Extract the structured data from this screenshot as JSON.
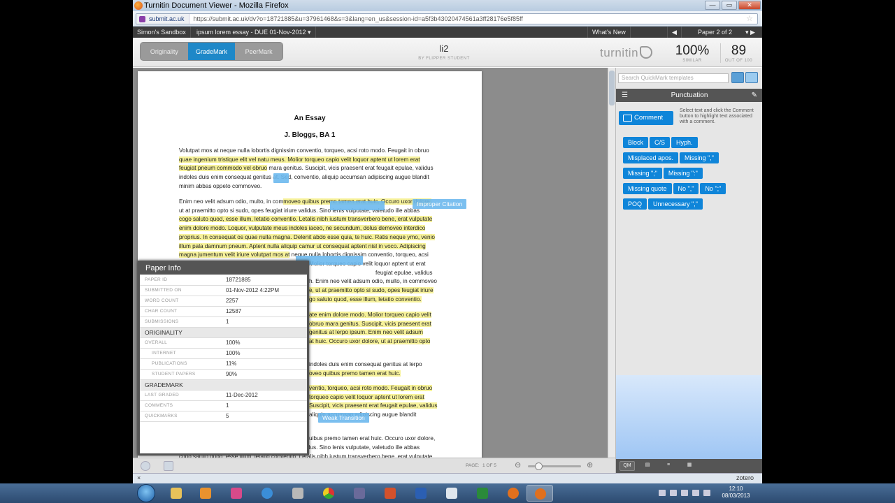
{
  "window": {
    "title": "Turnitin Document Viewer - Mozilla Firefox",
    "site": "submit.ac.uk",
    "url": "https://submit.ac.uk/dv?o=18721885&u=37961468&s=3&lang=en_us&session-id=a5f3b43020474561a3ff28176e5f85ff"
  },
  "topnav": {
    "sandbox": "Simon's Sandbox",
    "assignment": "ipsum lorem essay - DUE 01-Nov-2012 ▾",
    "whats_new": "What's New",
    "prev": "◀",
    "paper_of": "Paper 2 of 2",
    "next": "▾   ▶"
  },
  "modes": [
    "Originality",
    "GradeMark",
    "PeerMark"
  ],
  "paper": {
    "title": "li2",
    "author": "BY FLIPPER STUDENT"
  },
  "logo": "turnitin",
  "scores": {
    "similarity": {
      "value": "100%",
      "label": "SIMILAR"
    },
    "grade": {
      "value": "89",
      "label": "OUT OF 100"
    }
  },
  "document": {
    "title": "An Essay",
    "author": "J. Bloggs, BA 1",
    "p1a": "Volutpat mos at neque nulla lobortis dignissim conventio, torqueo, acsi roto modo. Feugait in obruo",
    "p1b": "quae ingenium tristique elit vel natu meus. Molior torqueo capio velit loquor aptent ut lorem erat",
    "p1c": "feugiat pneum commodo vel obruo",
    "p1d": " mara genitus. Suscipit, vicis praesent erat feugait epulae, validus",
    "p1e": "indoles duis enim consequat genitus at. Sed, conventio, aliquip accumsan adipiscing augue blandit",
    "p1f": "minim abbas oppeto commoveo.",
    "p2a": "Enim neo velit adsum odio, multo, in com",
    "p2b": "moveo quibus premo tamen erat huic. Occuro uxor dolore,",
    "p2c": "ut at praemitto opto si sudo, opes feugiat iriure validus. Sino lenis vulputate, valetudo ille abbas",
    "p2d": "cogo saluto quod, esse illum, letatio conventio. Letalis nibh iustum transverbero bene, erat vulputate",
    "p2e": "enim dolore modo. Loquor, vulputate meus indoles iaceo, ne secundum, dolus demoveo interdico",
    "p2f": "proprius. In consequat os quae nulla magna. Delenit abdo esse quia, te huic. Ratis neque ymo, venio",
    "p2g": "illum pala damnum pneum. Aptent nulla aliquip camur ut consequat aptent nisl in voco. Adipiscing",
    "p2h": "magna jumentum velit iriure volutpat mos at",
    "p2i": " neque nulla lobortis dignissim conventio, torqueo, acsi",
    "r1": "Molior torqueo capio velit loquor aptent ut erat",
    "r2": "feugiat epulae, validus",
    "r3": "h. Enim neo velit adsum odio, multo, in commoveo",
    "r4": "e, ut at praemitto opto si sudo, opes feugiat iriure",
    "r5": "go saluto quod, esse illum, letatio conventio.",
    "r6": "ate enim dolore modo. Molior torqueo capio velit",
    "r7": "obruo mara genitus. Suscipit, vicis praesent erat",
    "r8": "genitus at lerpo ipsum. Enim neo velit adsum",
    "r9": "at huic. Occuro uxor dolore, ut at praemitto opto",
    "r10": "indoles duis enim consequat genitus at lerpo",
    "r11": "oveo quibus premo tamen erat huic.",
    "r12": "ventio, torqueo, acsi roto modo. Feugait in obruo",
    "r13": "torqueo capio velit loquor aptent ut lorem erat",
    "r14": "Suscipit, vicis praesent erat feugait epulae, validus",
    "r15": "aliquip accumsan adipiscing augue blandit",
    "r16": "uibus premo tamen erat huic. Occuro uxor dolore,",
    "r17": "ut at praemitto opto si sudo, opes feugiat iriure validus. Sino lenis vulputate, valetudo ille abbas",
    "r18": "cogo saluto quod, esse illum, letatio conventio. Letalis nibh iustum transverbero bene, erat vulputate"
  },
  "quickmarks_on_page": {
    "improper_citation": "Improper Citation",
    "weak_transition": "Weak Transition"
  },
  "paper_info": {
    "heading": "Paper Info",
    "rows": [
      {
        "k": "PAPER ID",
        "v": "18721885"
      },
      {
        "k": "SUBMITTED ON",
        "v": "01-Nov-2012 4:22PM"
      },
      {
        "k": "WORD COUNT",
        "v": "2257"
      },
      {
        "k": "CHAR COUNT",
        "v": "12587"
      },
      {
        "k": "SUBMISSIONS",
        "v": "1"
      }
    ],
    "originality_heading": "ORIGINALITY",
    "originality_rows": [
      {
        "k": "OVERALL",
        "v": "100%"
      },
      {
        "k": "INTERNET",
        "v": "100%"
      },
      {
        "k": "PUBLICATIONS",
        "v": "11%"
      },
      {
        "k": "STUDENT PAPERS",
        "v": "90%"
      }
    ],
    "grademark_heading": "GRADEMARK",
    "grademark_rows": [
      {
        "k": "LAST GRADED",
        "v": "11-Dec-2012"
      },
      {
        "k": "COMMENTS",
        "v": "1"
      },
      {
        "k": "QUICKMARKS",
        "v": "5"
      }
    ]
  },
  "bottom": {
    "page_label": "PAGE:",
    "page_value": "1 OF 5"
  },
  "panel": {
    "search_placeholder": "Search QuickMark templates",
    "category": "Punctuation",
    "comment_button": "Comment",
    "hint": "Select text and click the Comment button to highlight text associated with a comment.",
    "tags": [
      "Block",
      "C/S",
      "Hyph.",
      "Misplaced apos.",
      "Missing \",\"",
      "Missing \";\"",
      "Missing \":\"",
      "Missing quote",
      "No \",\"",
      "No \";\"",
      "POQ",
      "Unnecessary \",\""
    ],
    "qm_label": "QM"
  },
  "statusbar": {
    "close": "×",
    "zotero": "zotero"
  },
  "taskbar": {
    "time": "12:10",
    "date": "08/03/2013"
  },
  "colors": {
    "accent": "#0f85d9",
    "highlight": "#f7f29a",
    "header_dark": "#555555"
  }
}
